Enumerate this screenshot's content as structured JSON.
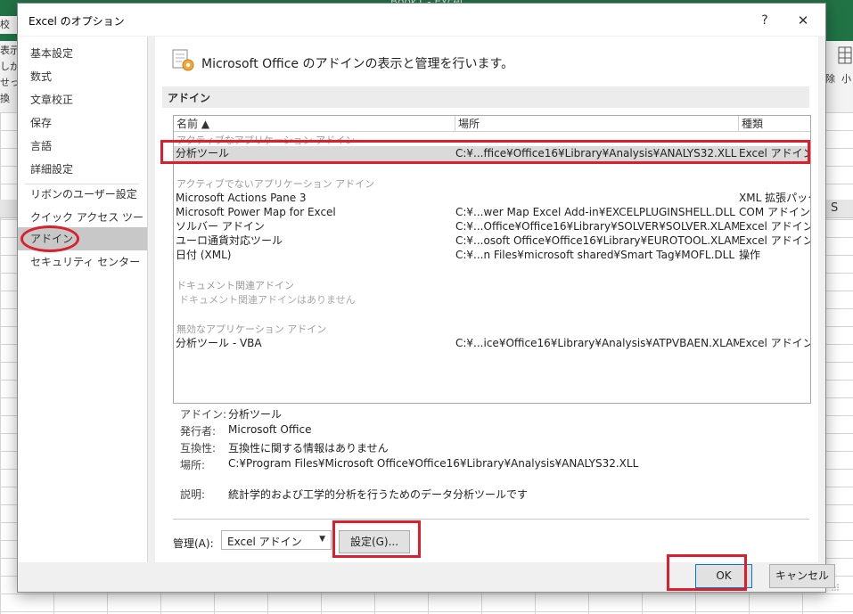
{
  "background": {
    "app_title": "Book1 - Excel",
    "ribbon_tab_partial": "校",
    "left_fragments": [
      "表示",
      "しから",
      "せった",
      "換"
    ],
    "right_fragments": [
      "除",
      "小"
    ],
    "column_s": "S"
  },
  "dialog": {
    "title": "Excel のオプション",
    "help": "?",
    "close": "✕",
    "nav": [
      {
        "label": "基本設定"
      },
      {
        "label": "数式"
      },
      {
        "label": "文章校正"
      },
      {
        "label": "保存"
      },
      {
        "label": "言語"
      },
      {
        "label": "詳細設定"
      },
      {
        "label": "リボンのユーザー設定"
      },
      {
        "label": "クイック アクセス ツール バー"
      },
      {
        "label": "アドイン"
      },
      {
        "label": "セキュリティ センター"
      }
    ],
    "header_text": "Microsoft Office のアドインの表示と管理を行います。",
    "section_label": "アドイン",
    "columns": {
      "name": "名前 ▲",
      "location": "場所",
      "type": "種類"
    },
    "groups": {
      "active": "アクティブなアプリケーション アドイン",
      "inactive": "アクティブでないアプリケーション アドイン",
      "document": "ドキュメント関連アドイン",
      "document_none": "ドキュメント関連アドインはありません",
      "disabled": "無効なアプリケーション アドイン"
    },
    "active_rows": [
      {
        "name": "分析ツール",
        "location": "C:¥...ffice¥Office16¥Library¥Analysis¥ANALYS32.XLL",
        "type": "Excel アドイン"
      }
    ],
    "inactive_rows": [
      {
        "name": "Microsoft Actions Pane 3",
        "location": "",
        "type": "XML 拡張パック"
      },
      {
        "name": "Microsoft Power Map for Excel",
        "location": "C:¥...wer Map Excel Add-in¥EXCELPLUGINSHELL.DLL",
        "type": "COM アドイン"
      },
      {
        "name": "ソルバー アドイン",
        "location": "C:¥...Office¥Office16¥Library¥SOLVER¥SOLVER.XLAM",
        "type": "Excel アドイン"
      },
      {
        "name": "ユーロ通貨対応ツール",
        "location": "C:¥...osoft Office¥Office16¥Library¥EUROTOOL.XLAM",
        "type": "Excel アドイン"
      },
      {
        "name": "日付 (XML)",
        "location": "C:¥...n Files¥microsoft shared¥Smart Tag¥MOFL.DLL",
        "type": "操作"
      }
    ],
    "disabled_rows": [
      {
        "name": "分析ツール - VBA",
        "location": "C:¥...ice¥Office16¥Library¥Analysis¥ATPVBAEN.XLAM",
        "type": "Excel アドイン"
      }
    ],
    "details": {
      "addin_label": "アドイン:",
      "addin_value": "分析ツール",
      "publisher_label": "発行者:",
      "publisher_value": "Microsoft Office",
      "compat_label": "互換性:",
      "compat_value": "互換性に関する情報はありません",
      "location_label": "場所:",
      "location_value": "C:¥Program Files¥Microsoft Office¥Office16¥Library¥Analysis¥ANALYS32.XLL",
      "desc_label": "説明:",
      "desc_value": "統計学的および工学的分析を行うためのデータ分析ツールです"
    },
    "manage_label": "管理(A):",
    "manage_value": "Excel アドイン",
    "go_button": "設定(G)...",
    "ok": "OK",
    "cancel": "キャンセル"
  },
  "colors": {
    "highlight_red": "#d9202c",
    "excel_green": "#217346",
    "ok_border": "#0078d7"
  }
}
